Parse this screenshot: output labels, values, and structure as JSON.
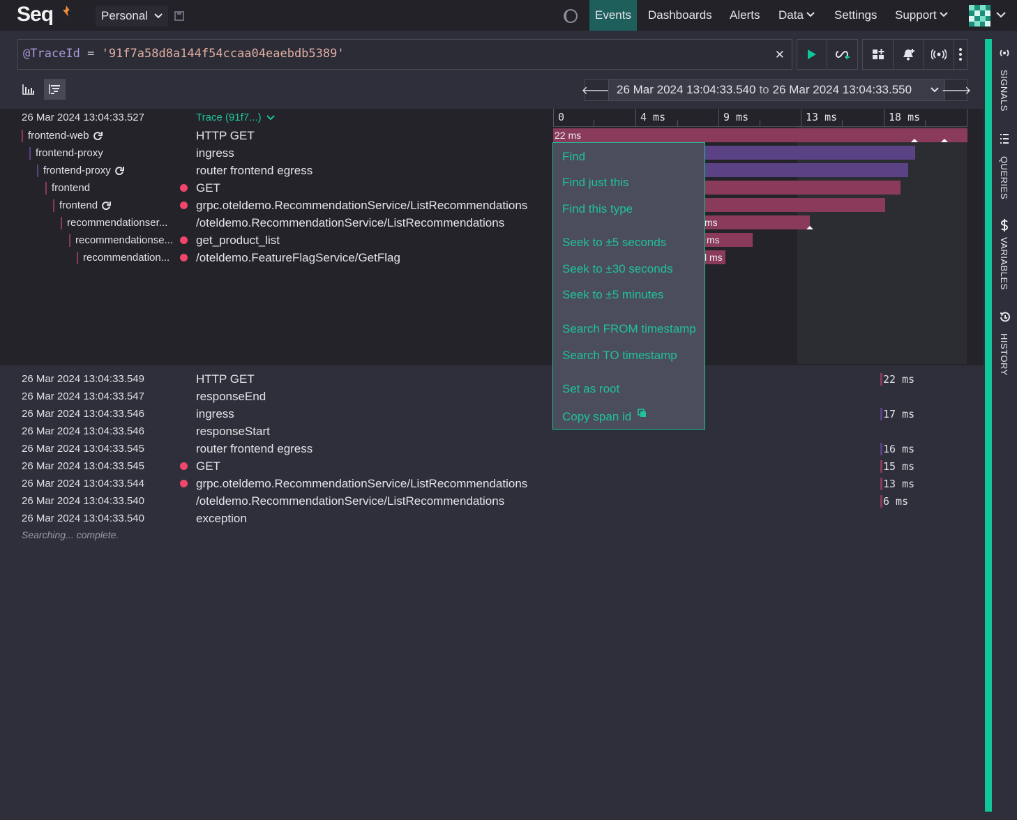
{
  "app": {
    "logo_text": "Seq",
    "workspace": "Personal"
  },
  "nav": {
    "items": [
      "Events",
      "Dashboards",
      "Alerts",
      "Data",
      "Settings",
      "Support"
    ],
    "active": "Events"
  },
  "query": {
    "keyword": "@TraceId",
    "operator": " = ",
    "value": "'91f7a58d8a144f54ccaa04eaebdb5389'"
  },
  "range": {
    "from": "26 Mar 2024 13:04:33.540",
    "to_word": "to",
    "to": "26 Mar 2024 13:04:33.550"
  },
  "trace": {
    "date": "26 Mar 2024  13:04:33.527",
    "link": "Trace (91f7...)",
    "axis_ticks": [
      "0",
      "4 ms",
      "9 ms",
      "13 ms",
      "18 ms"
    ],
    "spans": [
      {
        "service": "frontend-web",
        "name": "HTTP GET",
        "error": false,
        "duration": "22 ms",
        "link_icon": true
      },
      {
        "service": "frontend-proxy",
        "name": "ingress",
        "error": false,
        "duration": "",
        "link_icon": false
      },
      {
        "service": "frontend-proxy",
        "name": "router frontend egress",
        "error": false,
        "duration": "",
        "link_icon": true
      },
      {
        "service": "frontend",
        "name": "GET",
        "error": true,
        "duration": "",
        "link_icon": false
      },
      {
        "service": "frontend",
        "name": "grpc.oteldemo.RecommendationService/ListRecommendations",
        "error": true,
        "duration": "",
        "link_icon": true
      },
      {
        "service": "recommendationser...",
        "name": "/oteldemo.RecommendationService/ListRecommendations",
        "error": false,
        "duration": "ms",
        "link_icon": false
      },
      {
        "service": "recommendationse...",
        "name": "get_product_list",
        "error": true,
        "duration": "ms",
        "link_icon": false
      },
      {
        "service": "recommendation...",
        "name": "/oteldemo.FeatureFlagService/GetFlag",
        "error": true,
        "duration": "l ms",
        "link_icon": false
      }
    ]
  },
  "events": [
    {
      "date": "26 Mar 2024  13:04:33.549",
      "message": "HTTP GET",
      "error": false,
      "duration": "22 ms"
    },
    {
      "date": "26 Mar 2024  13:04:33.547",
      "message": "responseEnd",
      "error": false,
      "duration": ""
    },
    {
      "date": "26 Mar 2024  13:04:33.546",
      "message": "ingress",
      "error": false,
      "duration": "17 ms"
    },
    {
      "date": "26 Mar 2024  13:04:33.546",
      "message": "responseStart",
      "error": false,
      "duration": ""
    },
    {
      "date": "26 Mar 2024  13:04:33.545",
      "message": "router frontend egress",
      "error": false,
      "duration": "16 ms"
    },
    {
      "date": "26 Mar 2024  13:04:33.545",
      "message": "GET",
      "error": true,
      "duration": "15 ms"
    },
    {
      "date": "26 Mar 2024  13:04:33.544",
      "message": "grpc.oteldemo.RecommendationService/ListRecommendations",
      "error": true,
      "duration": "13 ms"
    },
    {
      "date": "26 Mar 2024  13:04:33.540",
      "message": "/oteldemo.RecommendationService/ListRecommendations",
      "error": false,
      "duration": "6 ms"
    },
    {
      "date": "26 Mar 2024  13:04:33.540",
      "message": "exception",
      "error": false,
      "duration": ""
    }
  ],
  "status": "Searching... complete.",
  "context_menu": {
    "items": [
      "Find",
      "Find just this",
      "Find this type",
      "Seek to ±5 seconds",
      "Seek to ±30 seconds",
      "Seek to ±5 minutes",
      "Search FROM timestamp",
      "Search TO timestamp",
      "Set as root",
      "Copy span id"
    ]
  },
  "sidebar": {
    "items": [
      "SIGNALS",
      "QUERIES",
      "VARIABLES",
      "HISTORY"
    ]
  },
  "colors": {
    "accent": "#1fc29a",
    "error": "#f1466c",
    "span_web": "#8a3b5a",
    "span_proxy": "#5b4285"
  }
}
